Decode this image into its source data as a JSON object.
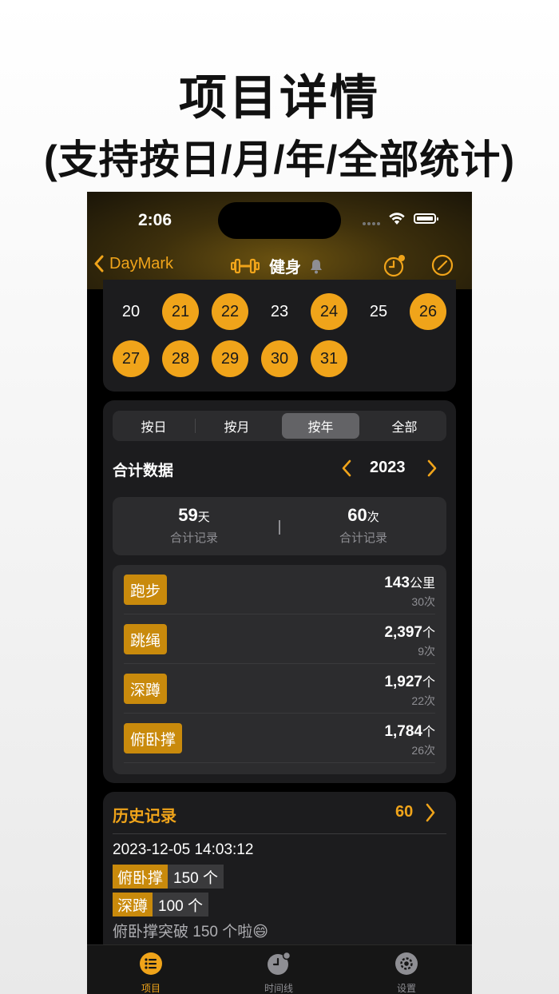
{
  "promo": {
    "title": "项目详情",
    "subtitle": "(支持按日/月/年/全部统计)"
  },
  "status_bar": {
    "time": "2:06"
  },
  "nav": {
    "back_label": "DayMark",
    "title": "健身",
    "icons": [
      "chevron-left-icon",
      "dumbbell-icon",
      "bell-icon",
      "clock-icon",
      "pencil-icon"
    ]
  },
  "calendar": {
    "days": [
      {
        "label": "20",
        "done": false
      },
      {
        "label": "21",
        "done": true
      },
      {
        "label": "22",
        "done": true
      },
      {
        "label": "23",
        "done": false
      },
      {
        "label": "24",
        "done": true
      },
      {
        "label": "25",
        "done": false
      },
      {
        "label": "26",
        "done": true
      },
      {
        "label": "27",
        "done": true
      },
      {
        "label": "28",
        "done": true
      },
      {
        "label": "29",
        "done": true
      },
      {
        "label": "30",
        "done": true
      },
      {
        "label": "31",
        "done": true
      }
    ]
  },
  "segments": {
    "items": [
      "按日",
      "按月",
      "按年",
      "全部"
    ],
    "selected": "按年"
  },
  "summary": {
    "title": "合计数据",
    "year": "2023",
    "days_value": "59",
    "days_unit": "天",
    "days_label": "合计记录",
    "count_value": "60",
    "count_unit": "次",
    "count_label": "合计记录"
  },
  "items": [
    {
      "name": "跑步",
      "value": "143",
      "unit": "公里",
      "times": "30次"
    },
    {
      "name": "跳绳",
      "value": "2,397",
      "unit": "个",
      "times": "9次"
    },
    {
      "name": "深蹲",
      "value": "1,927",
      "unit": "个",
      "times": "22次"
    },
    {
      "name": "俯卧撑",
      "value": "1,784",
      "unit": "个",
      "times": "26次"
    }
  ],
  "history": {
    "title": "历史记录",
    "count": "60",
    "entry": {
      "datetime": "2023-12-05 14:03:12",
      "chips": [
        {
          "name": "俯卧撑",
          "value": "150 个"
        },
        {
          "name": "深蹲",
          "value": "100 个"
        }
      ],
      "note": "俯卧撑突破 150 个啦😄"
    }
  },
  "tabbar": {
    "items": [
      {
        "label": "项目",
        "icon": "list-icon",
        "active": true
      },
      {
        "label": "时间线",
        "icon": "timeline-clock-icon",
        "active": false
      },
      {
        "label": "设置",
        "icon": "gear-icon",
        "active": false
      }
    ]
  },
  "colors": {
    "accent": "#f0a41a",
    "tag": "#c98a0c",
    "card": "#1c1c1e",
    "inner": "#2c2c2e",
    "background": "#000000"
  }
}
